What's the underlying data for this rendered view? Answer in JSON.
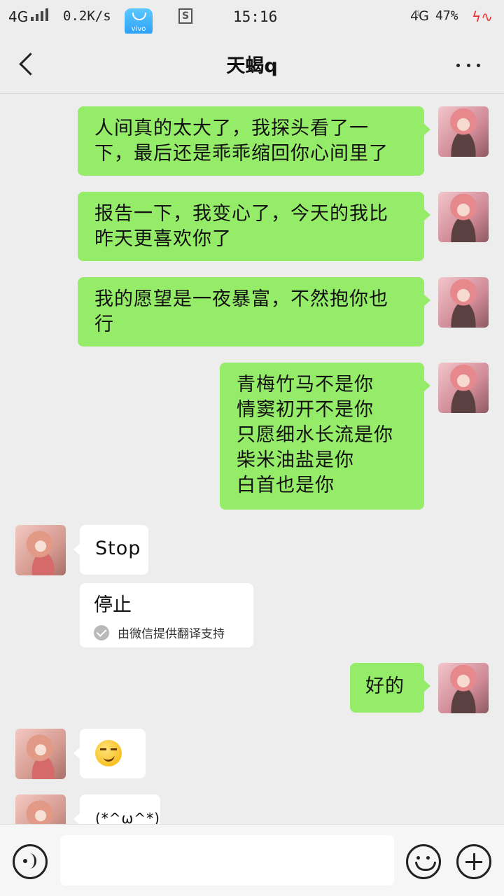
{
  "status_bar": {
    "network": "4G",
    "speed": "0.2K/s",
    "vivo_label": "vivo",
    "s_icon_label": "S",
    "time": "15:16",
    "network2": "4G",
    "network_arrows": "⇅",
    "battery": "47%",
    "pulse": "ϟ∿"
  },
  "header": {
    "title": "天蝎q",
    "back_icon": "back-arrow-icon",
    "more_icon": "more-dots-icon"
  },
  "messages": [
    {
      "side": "out",
      "lines": [
        "人间真的太大了，我探头看了一",
        "下，最后还是乖乖缩回你心间里了"
      ]
    },
    {
      "side": "out",
      "lines": [
        "报告一下，我变心了，今天的我比",
        "昨天更喜欢你了"
      ]
    },
    {
      "side": "out",
      "lines": [
        "我的愿望是一夜暴富，不然抱你也",
        "行"
      ]
    },
    {
      "side": "out",
      "lines": [
        "青梅竹马不是你",
        "情窦初开不是你",
        "只愿细水长流是你",
        "柴米油盐是你",
        "白首也是你"
      ]
    },
    {
      "side": "in",
      "text": "Stop"
    },
    {
      "side": "in",
      "translation": "停止",
      "translation_note": "由微信提供翻译支持"
    },
    {
      "side": "out",
      "text": "好的"
    },
    {
      "side": "in",
      "emoji": "smirk-emoji"
    },
    {
      "side": "in",
      "text": "(*^ω^*)"
    }
  ],
  "input_bar": {
    "voice_icon": "voice-icon",
    "input_value": "",
    "input_placeholder": "",
    "emoji_icon": "emoji-icon",
    "plus_icon": "plus-icon"
  },
  "colors": {
    "outgoing_bubble": "#95ec69",
    "incoming_bubble": "#ffffff",
    "background": "#ededed"
  }
}
